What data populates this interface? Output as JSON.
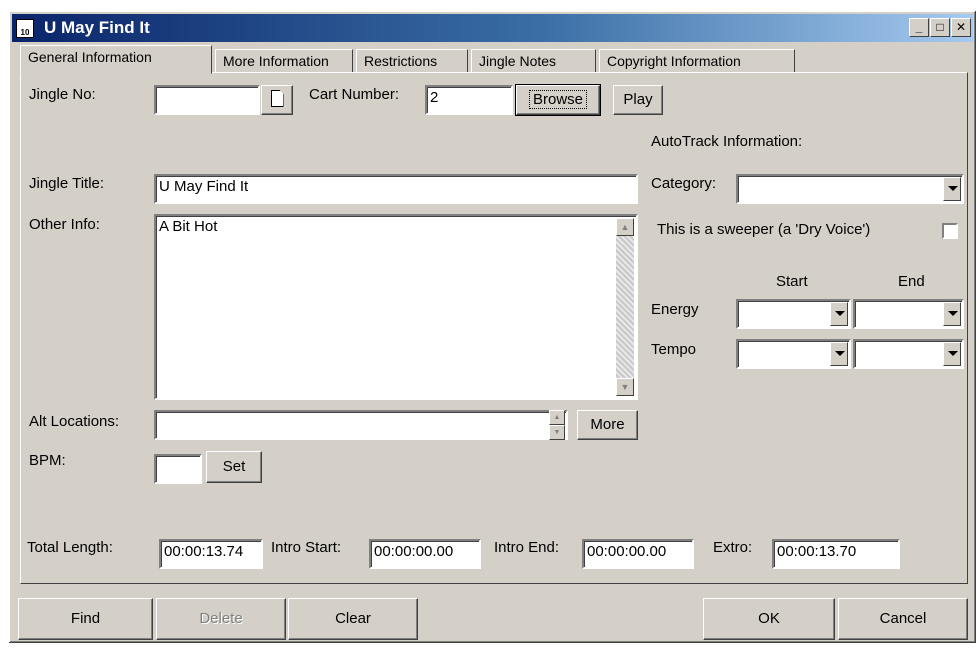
{
  "window": {
    "title": "U May Find It",
    "icon_text": "10",
    "buttons": {
      "minimize": "_",
      "maximize": "□",
      "close": "✕"
    }
  },
  "tabs": [
    {
      "label": "General Information"
    },
    {
      "label": "More Information"
    },
    {
      "label": "Restrictions"
    },
    {
      "label": "Jingle Notes"
    },
    {
      "label": "Copyright Information"
    }
  ],
  "form": {
    "jingle_no_label": "Jingle No:",
    "jingle_no_value": "",
    "cart_number_label": "Cart Number:",
    "cart_number_value": "2",
    "browse_label": "Browse",
    "play_label": "Play",
    "jingle_title_label": "Jingle Title:",
    "jingle_title_value": "U May Find It",
    "other_info_label": "Other Info:",
    "other_info_value": "A Bit Hot",
    "alt_locations_label": "Alt Locations:",
    "alt_locations_value": "",
    "more_label": "More",
    "bpm_label": "BPM:",
    "bpm_value": "",
    "set_label": "Set",
    "total_length_label": "Total Length:",
    "total_length_value": "00:00:13.74",
    "intro_start_label": "Intro Start:",
    "intro_start_value": "00:00:00.00",
    "intro_end_label": "Intro End:",
    "intro_end_value": "00:00:00.00",
    "extro_label": "Extro:",
    "extro_value": "00:00:13.70"
  },
  "autotrack": {
    "heading": "AutoTrack Information:",
    "category_label": "Category:",
    "category_value": "",
    "sweeper_label": "This is a sweeper (a 'Dry Voice')",
    "sweeper_checked": false,
    "start_label": "Start",
    "end_label": "End",
    "energy_label": "Energy",
    "tempo_label": "Tempo"
  },
  "footer": {
    "find_label": "Find",
    "delete_label": "Delete",
    "clear_label": "Clear",
    "ok_label": "OK",
    "cancel_label": "Cancel"
  }
}
